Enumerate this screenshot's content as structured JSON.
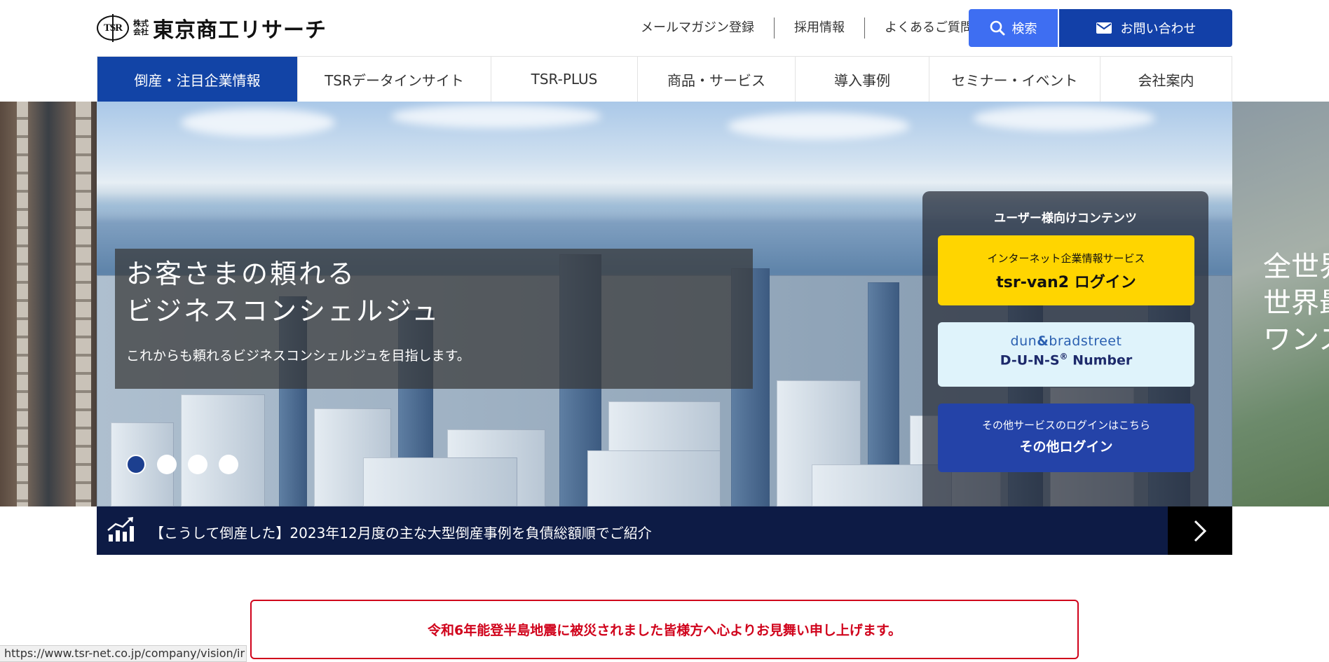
{
  "header": {
    "logo_mark": "TSR",
    "logo_kabushiki": [
      "株式",
      "会社"
    ],
    "company_name": "東京商工リサーチ",
    "top_links": [
      "メールマガジン登録",
      "採用情報",
      "よくあるご質問"
    ],
    "search_label": "検索",
    "contact_label": "お問い合わせ",
    "search_icon": "search-icon",
    "contact_icon": "mail-icon"
  },
  "nav": {
    "items": [
      {
        "label": "倒産・注目企業情報",
        "active": true
      },
      {
        "label": "TSRデータインサイト",
        "active": false
      },
      {
        "label": "TSR-PLUS",
        "active": false
      },
      {
        "label": "商品・サービス",
        "active": false
      },
      {
        "label": "導入事例",
        "active": false
      },
      {
        "label": "セミナー・イベント",
        "active": false
      },
      {
        "label": "会社案内",
        "active": false
      }
    ]
  },
  "hero": {
    "title_line1": "お客さまの頼れる",
    "title_line2": "ビジネスコンシェルジュ",
    "subtitle": "これからも頼れるビジネスコンシェルジュを目指します。",
    "next_slide_text": [
      "全世界",
      "世界最",
      "ワンス"
    ],
    "slide_count": 4,
    "active_slide": 1
  },
  "login_panel": {
    "title": "ユーザー様向けコンテンツ",
    "tsr_van2": {
      "small": "インターネット企業情報サービス",
      "big": "tsr-van2 ログイン",
      "color": "#ffd500"
    },
    "duns": {
      "brand_left": "dun",
      "brand_amp": "&",
      "brand_right": "bradstreet",
      "big": "D-U-N-S",
      "reg": "®",
      "big_suffix": " Number",
      "color": "#dff3fb"
    },
    "other": {
      "small": "その他サービスのログインはこちら",
      "big": "その他ログイン",
      "color": "#2443a8"
    }
  },
  "news": {
    "icon": "chart-up-icon",
    "text": "【こうして倒産した】2023年12月度の主な大型倒産事例を負債総額順でご紹介",
    "next_icon": "chevron-right-icon"
  },
  "notice": {
    "text": "令和6年能登半島地震に被災されました皆様方へ心よりお見舞い申し上げます。",
    "color": "#d0021b"
  },
  "status_bar": {
    "url": "https://www.tsr-net.co.jp/company/vision/ir"
  },
  "colors": {
    "nav_active": "#1244a6",
    "search_button": "#3e6ef2",
    "contact_button": "#1240a8",
    "news_bar": "#0d1b45"
  }
}
